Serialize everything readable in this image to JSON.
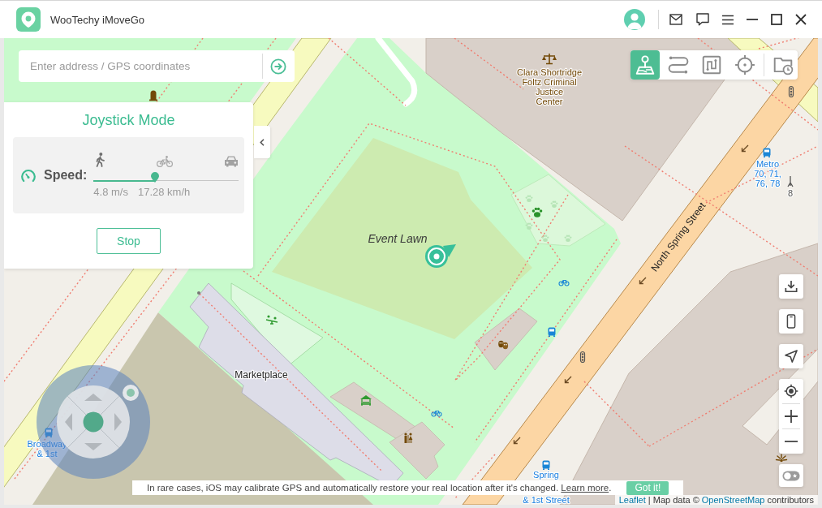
{
  "window": {
    "title": "WooTechy iMoveGo"
  },
  "search": {
    "placeholder": "Enter address / GPS coordinates"
  },
  "joystick_panel": {
    "title": "Joystick Mode",
    "speed_label": "Speed:",
    "slider": {
      "level": 0.42
    },
    "readings": [
      "4.8 m/s",
      "17.28 km/h"
    ],
    "button": "Stop"
  },
  "toolbar": {
    "modes": [
      {
        "kind": "joystick",
        "selected": true
      },
      {
        "kind": "multi",
        "selected": false
      },
      {
        "kind": "jump",
        "selected": false
      },
      {
        "kind": "teleport",
        "selected": false
      },
      {
        "kind": "history",
        "selected": false
      }
    ]
  },
  "map": {
    "labels": [
      {
        "kind": "area",
        "text": "Event Lawn"
      },
      {
        "kind": "building",
        "lines": [
          "Clara Shortridge",
          "Foltz Criminal",
          "Justice",
          "Center"
        ]
      },
      {
        "kind": "street",
        "text": "North Spring Street"
      },
      {
        "kind": "place",
        "text": "Marketplace"
      },
      {
        "kind": "transit",
        "lines": [
          "Metro",
          "70, 71,",
          "76, 78"
        ]
      },
      {
        "kind": "ref",
        "text": "8"
      },
      {
        "kind": "transit",
        "lines": [
          "Broadway",
          "& 1st"
        ]
      },
      {
        "kind": "transit",
        "text": "Spring"
      },
      {
        "kind": "transit",
        "text": "& 1st Street"
      }
    ]
  },
  "side_controls": {
    "toggle": {
      "on": false
    }
  },
  "notice": {
    "text": "In rare cases, iOS may calibrate GPS and automatically restore your real location after it's changed.",
    "link": "Learn more",
    "suffix": ".",
    "button": "Got it!"
  },
  "attribution": {
    "leaflet": "Leaflet",
    "text": "| Map data ©",
    "osm": "OpenStreetMap",
    "suffix": "contributors"
  }
}
